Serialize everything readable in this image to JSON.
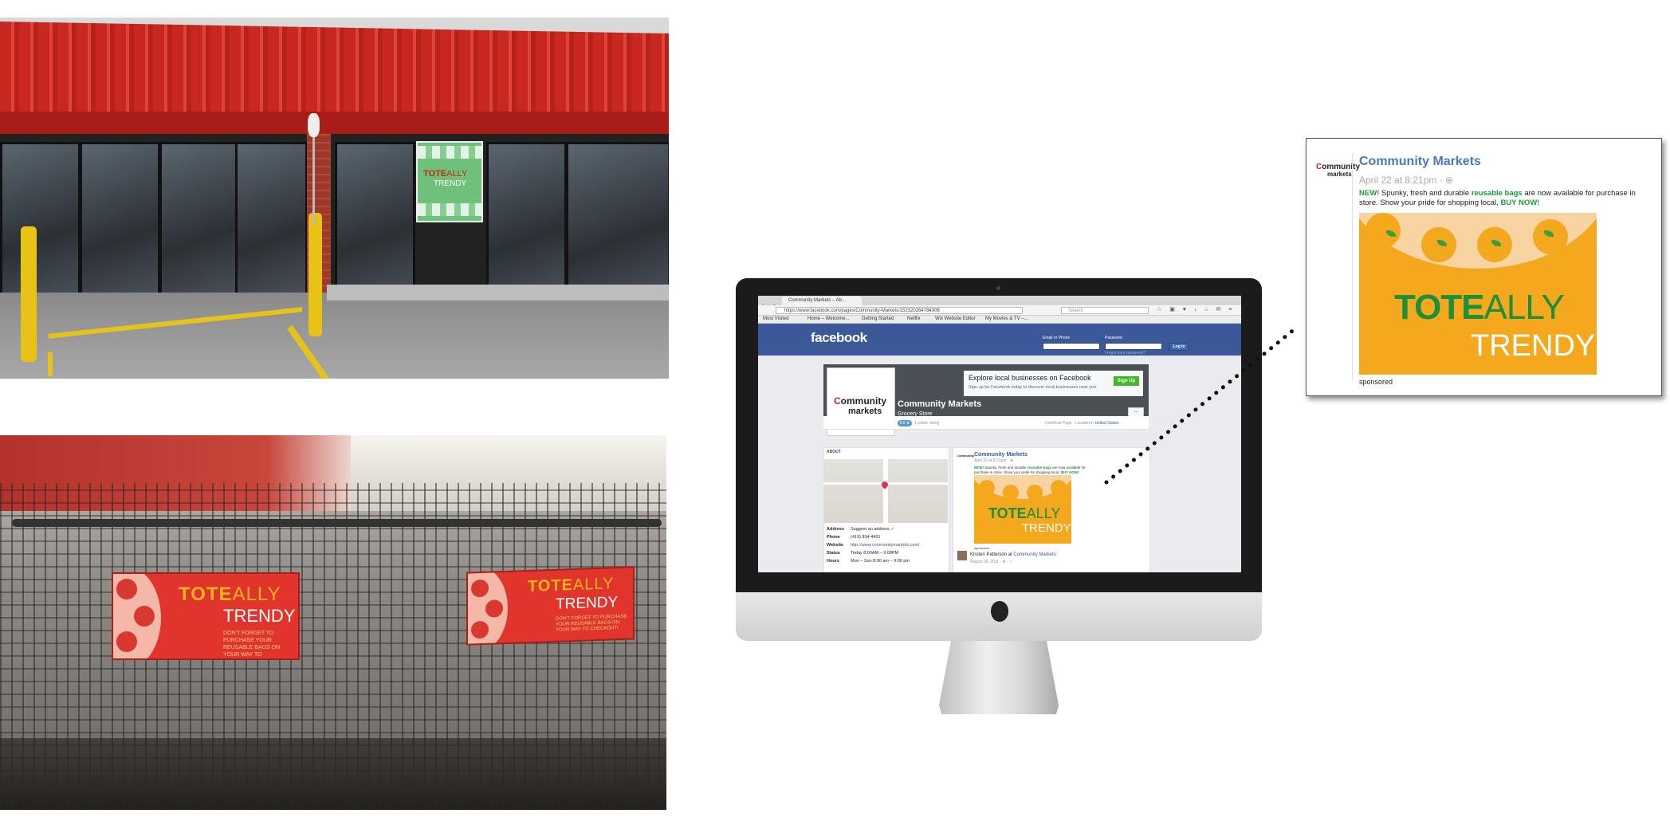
{
  "browser": {
    "tab_title": "Community Markets – Ab...",
    "url": "https://www.facebook.com/pages/Community-Markets/152320264784306",
    "search_placeholder": "Search",
    "bookmarks": [
      "Most Visited",
      "Home – Welcome...",
      "Getting Started",
      "Netflix",
      "Wix Website Editor",
      "My Movies & TV –..."
    ]
  },
  "facebook": {
    "logo": "facebook",
    "email_label": "Email or Phone",
    "password_label": "Password",
    "login_button": "Log In",
    "forgot": "Forgot your password?",
    "page_name": "Community Markets",
    "page_category": "Grocery Store",
    "explore_title": "Explore local businesses on Facebook",
    "explore_sub": "Sign up for Facebook today to discover local businesses near you.",
    "signup_button": "Sign Up",
    "more_button": "...",
    "rating_badge": "3.0 ★",
    "rating_text": "1 public rating",
    "unofficial": "Unofficial Page · Located in",
    "located_link": "United States",
    "about_label": "ABOUT",
    "info": [
      {
        "label": "Address",
        "value": "Suggest an address ✓"
      },
      {
        "label": "Phone",
        "value": "(419) 834-4491"
      },
      {
        "label": "Website",
        "value": "http://www.communitymarkets.com/"
      },
      {
        "label": "Status",
        "value": "Today 8:00AM – 9:00PM"
      },
      {
        "label": "Hours",
        "value": "Mon – Sun 8:00 am – 9:00 pm"
      }
    ],
    "post_name": "Community Markets",
    "post_date": "April 22 at 8:21pm · ⊕",
    "commenter": "Kirsten Patterson",
    "commenter_at": "at",
    "commenter_place": "Community Markets.",
    "comment_date": "August 20, 2011 · ⊕ · ✓"
  },
  "ad_card": {
    "page_name": "Community Markets",
    "date": "April 22 at 8:21pm · ⊕",
    "body_new": "NEW!",
    "body_1": " Spunky, fresh and durable ",
    "body_bags": "reusable bags",
    "body_2": " are now available for purchase in store. Show your pride for shopping local, ",
    "body_buy": "BUY NOW!",
    "sponsored": "sponsored"
  },
  "artwork": {
    "tote": "TOTE",
    "ally": "ALLY",
    "trendy": "TRENDY",
    "cart_note": "DON'T FORGET TO PURCHASE YOUR REUSABLE BAGS ON YOUR WAY TO CHECKOUT!"
  },
  "logo": {
    "c": "C",
    "ommunity": "ommunity",
    "markets": "markets"
  },
  "colors": {
    "facebook_blue": "#3b5998",
    "tote_green": "#1b8f3a",
    "ad_orange": "#f4a81d",
    "cart_sign_red": "#e0342d",
    "roof_red": "#c8281f"
  }
}
